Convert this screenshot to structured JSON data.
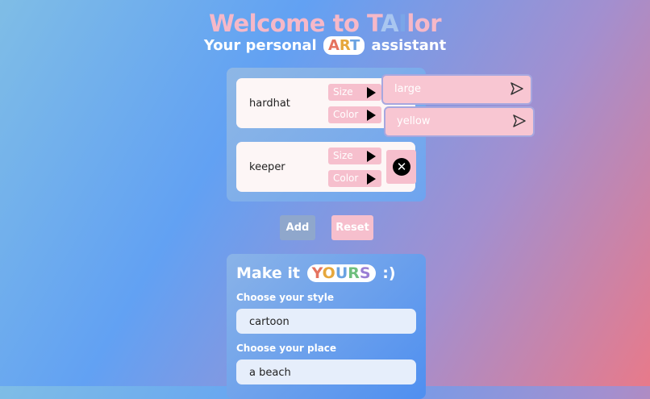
{
  "header": {
    "title_part1": "Welcome to T",
    "title_a": "A",
    "title_i": "I",
    "title_part2": "lor",
    "subtitle_pre": "Your personal",
    "subtitle_badge": [
      "A",
      "R",
      "T"
    ],
    "subtitle_post": "assistant"
  },
  "items": [
    {
      "name": "hardhat",
      "size_label": "Size",
      "color_label": "Color"
    },
    {
      "name": "keeper",
      "size_label": "Size",
      "color_label": "Color"
    }
  ],
  "popups": {
    "size_value": "large",
    "color_value": "yellow"
  },
  "buttons": {
    "add": "Add",
    "reset": "Reset"
  },
  "customize": {
    "title_pre": "Make it",
    "title_badge": [
      "Y",
      "O",
      "U",
      "R",
      "S"
    ],
    "title_post": ":)",
    "style_label": "Choose your style",
    "style_value": "cartoon",
    "place_label": "Choose your place",
    "place_value": "a beach"
  },
  "icons": {
    "play": "play-icon",
    "remove": "close-circle-icon",
    "send": "send-icon"
  }
}
